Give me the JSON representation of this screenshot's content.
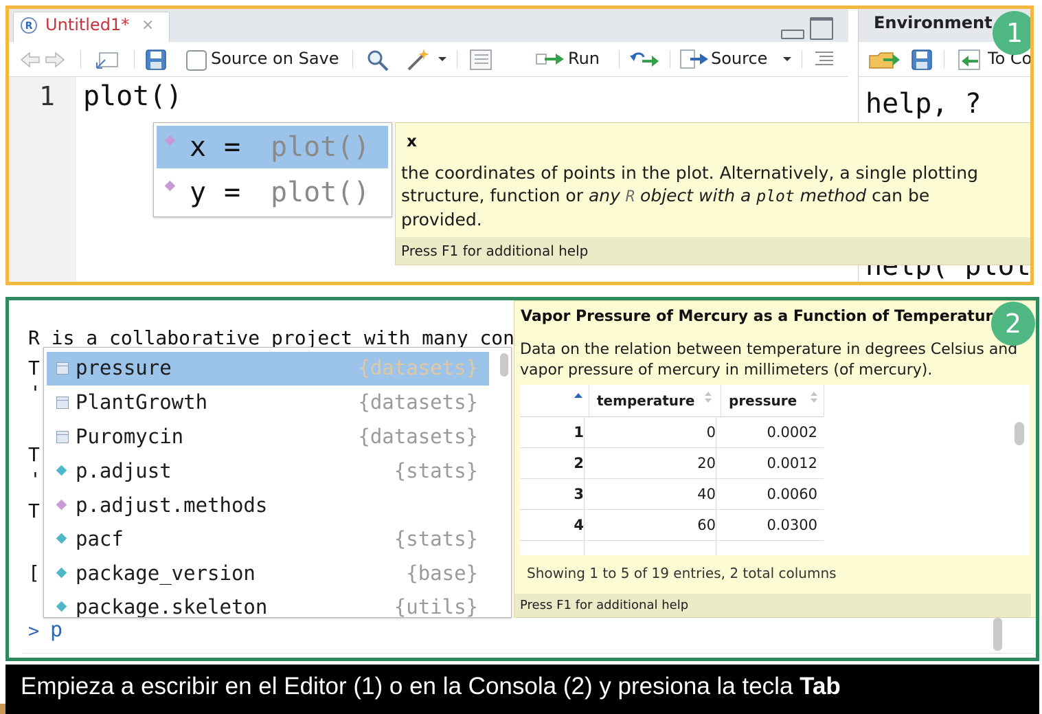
{
  "editor": {
    "tab_title": "Untitled1*",
    "tab_close": "×",
    "source_on_save": "Source on Save",
    "run": "Run",
    "source": "Source",
    "line_number": "1",
    "code_text": "plot()"
  },
  "editor_completion": {
    "items": [
      {
        "arg": "x",
        "eq": "=",
        "func": "plot()"
      },
      {
        "arg": "y",
        "eq": "=",
        "func": "plot()"
      }
    ]
  },
  "editor_tooltip": {
    "arg_name": "x",
    "line1": "the coordinates of points in the plot. Alternatively, a single plotting",
    "line2_a": "structure, function or ",
    "line2_italic_a": "any ",
    "line2_code_r": "R",
    "line2_italic_b": " object with a ",
    "line2_code_plot": "plot",
    "line2_italic_c": " method",
    "line2_b": " can be",
    "line3": "provided.",
    "footer": "Press F1 for additional help"
  },
  "env_pane": {
    "tab_title": "Environment",
    "to_console": "To Co",
    "help_text": "help, ?",
    "help_bottom": "help('plot'"
  },
  "console": {
    "line1": "R is a collaborative project with many cont",
    "partial_chars": [
      "T",
      "'",
      "T",
      "'",
      "T",
      "["
    ],
    "prompt": ">",
    "input": "p"
  },
  "console_completion": {
    "items": [
      {
        "label": "pressure",
        "pkg": "{datasets}",
        "icon": "table-icon",
        "selected": true
      },
      {
        "label": "PlantGrowth",
        "pkg": "{datasets}",
        "icon": "table-icon"
      },
      {
        "label": "Puromycin",
        "pkg": "{datasets}",
        "icon": "table-icon"
      },
      {
        "label": "p.adjust",
        "pkg": "{stats}",
        "icon": "function-icon"
      },
      {
        "label": "p.adjust.methods",
        "pkg": "",
        "icon": "variable-icon"
      },
      {
        "label": "pacf",
        "pkg": "{stats}",
        "icon": "function-icon"
      },
      {
        "label": "package_version",
        "pkg": "{base}",
        "icon": "function-icon"
      },
      {
        "label": "package.skeleton",
        "pkg": "{utils}",
        "icon": "function-icon"
      }
    ]
  },
  "console_tooltip": {
    "title": "Vapor Pressure of Mercury as a Function of Temperature",
    "desc_line1": "Data on the relation between temperature in degrees Celsius and",
    "desc_line2": "vapor pressure of mercury in millimeters (of mercury).",
    "columns": [
      "temperature",
      "pressure"
    ],
    "rows": [
      {
        "idx": "1",
        "temperature": "0",
        "pressure": "0.0002"
      },
      {
        "idx": "2",
        "temperature": "20",
        "pressure": "0.0012"
      },
      {
        "idx": "3",
        "temperature": "40",
        "pressure": "0.0060"
      },
      {
        "idx": "4",
        "temperature": "60",
        "pressure": "0.0300"
      }
    ],
    "showing": "Showing 1 to 5 of 19 entries, 2 total columns",
    "footer": "Press F1 for additional help"
  },
  "badges": {
    "one": "1",
    "two": "2"
  },
  "caption": {
    "text": "Empieza a escribir en el Editor (1) o en la Consola (2) y presiona la tecla ",
    "bold": "Tab"
  },
  "colors": {
    "panel1_border": "#f4b73f",
    "panel2_border": "#2e8a5e",
    "badge": "#4fb882",
    "selection": "#9cc3ea",
    "tooltip_bg": "#fdfbd3"
  }
}
